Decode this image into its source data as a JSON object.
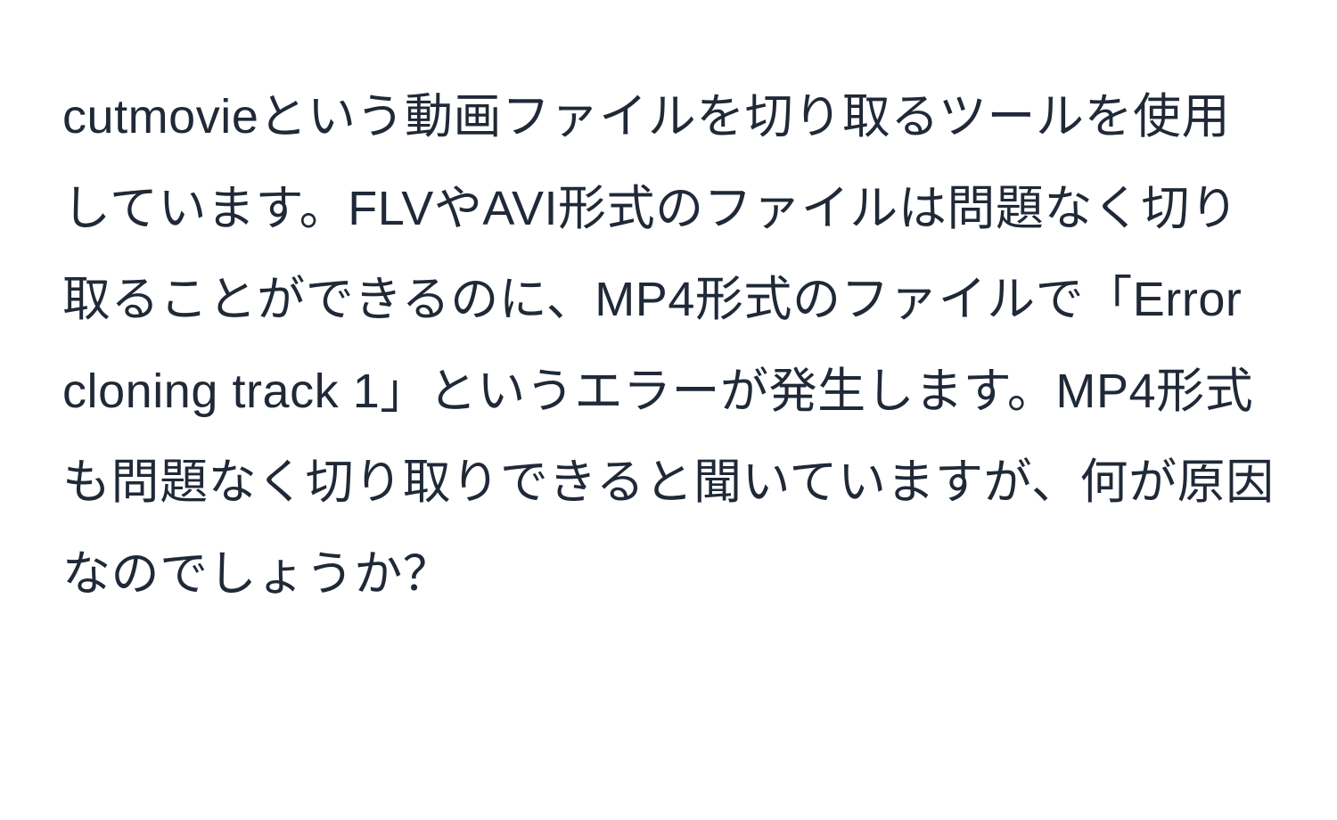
{
  "paragraph": {
    "text": "cutmovieという動画ファイルを切り取るツールを使用しています。FLVやAVI形式のファイルは問題なく切り取ることができるのに、MP4形式のファイルで「Error cloning track 1」というエラーが発生します。MP4形式も問題なく切り取りできると聞いていますが、何が原因なのでしょうか？"
  }
}
